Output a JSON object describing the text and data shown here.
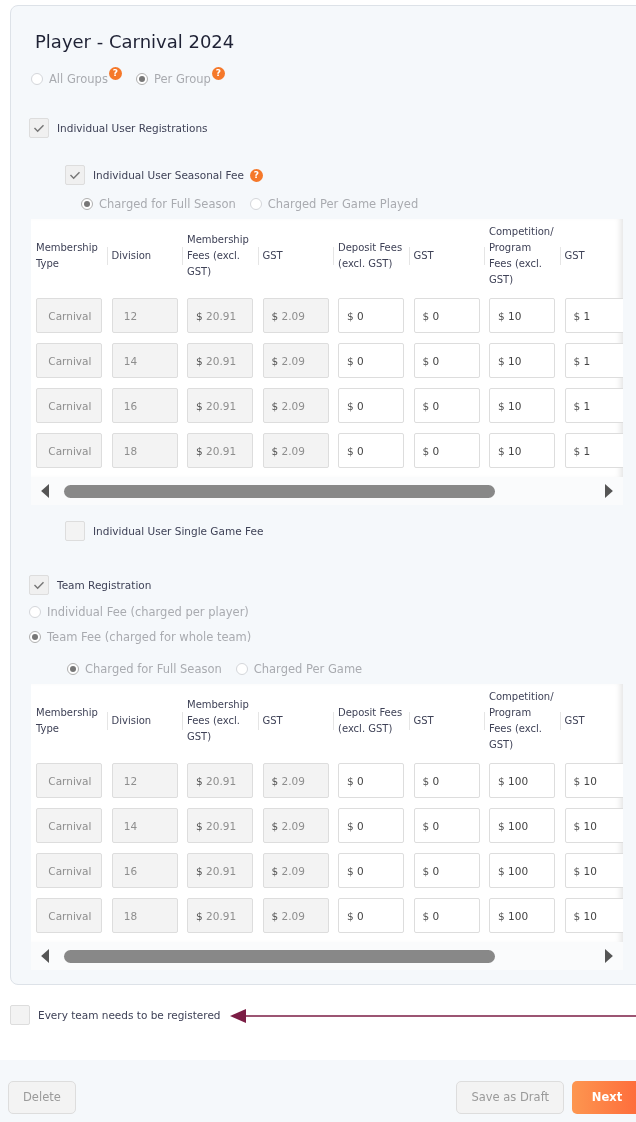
{
  "title": "Player - Carnival 2024",
  "fee_scope": {
    "disabled": true,
    "options": [
      {
        "label": "All Groups",
        "selected": false,
        "help": "?"
      },
      {
        "label": "Per Group",
        "selected": true,
        "help": "?"
      }
    ]
  },
  "individual": {
    "label": "Individual User Registrations",
    "checked": true,
    "seasonal": {
      "label": "Individual User Seasonal Fee",
      "checked": true,
      "help": "?",
      "charge": {
        "disabled": true,
        "options": [
          {
            "label": "Charged for Full Season",
            "selected": true
          },
          {
            "label": "Charged Per Game Played",
            "selected": false
          }
        ]
      },
      "table": {
        "columns": [
          "Membership Type",
          "Division",
          "Membership Fees (excl. GST)",
          "GST",
          "Deposit Fees (excl. GST)",
          "GST",
          "Competition/Program Fees (excl. GST)",
          "GST"
        ],
        "rows": [
          {
            "cells": [
              {
                "value": "Carnival",
                "disabled": true
              },
              {
                "value": "12",
                "disabled": true
              },
              {
                "prefix": "$",
                "value": "20.91",
                "disabled": true
              },
              {
                "prefix": "$",
                "value": "2.09",
                "disabled": true
              },
              {
                "prefix": "$",
                "value": "0",
                "disabled": false
              },
              {
                "prefix": "$",
                "value": "0",
                "disabled": false
              },
              {
                "prefix": "$",
                "value": "10",
                "disabled": false
              },
              {
                "prefix": "$",
                "value": "1",
                "disabled": false
              }
            ]
          },
          {
            "cells": [
              {
                "value": "Carnival",
                "disabled": true
              },
              {
                "value": "14",
                "disabled": true
              },
              {
                "prefix": "$",
                "value": "20.91",
                "disabled": true
              },
              {
                "prefix": "$",
                "value": "2.09",
                "disabled": true
              },
              {
                "prefix": "$",
                "value": "0",
                "disabled": false
              },
              {
                "prefix": "$",
                "value": "0",
                "disabled": false
              },
              {
                "prefix": "$",
                "value": "10",
                "disabled": false
              },
              {
                "prefix": "$",
                "value": "1",
                "disabled": false
              }
            ]
          },
          {
            "cells": [
              {
                "value": "Carnival",
                "disabled": true
              },
              {
                "value": "16",
                "disabled": true
              },
              {
                "prefix": "$",
                "value": "20.91",
                "disabled": true
              },
              {
                "prefix": "$",
                "value": "2.09",
                "disabled": true
              },
              {
                "prefix": "$",
                "value": "0",
                "disabled": false
              },
              {
                "prefix": "$",
                "value": "0",
                "disabled": false
              },
              {
                "prefix": "$",
                "value": "10",
                "disabled": false
              },
              {
                "prefix": "$",
                "value": "1",
                "disabled": false
              }
            ]
          },
          {
            "cells": [
              {
                "value": "Carnival",
                "disabled": true
              },
              {
                "value": "18",
                "disabled": true
              },
              {
                "prefix": "$",
                "value": "20.91",
                "disabled": true
              },
              {
                "prefix": "$",
                "value": "2.09",
                "disabled": true
              },
              {
                "prefix": "$",
                "value": "0",
                "disabled": false
              },
              {
                "prefix": "$",
                "value": "0",
                "disabled": false
              },
              {
                "prefix": "$",
                "value": "10",
                "disabled": false
              },
              {
                "prefix": "$",
                "value": "1",
                "disabled": false
              }
            ]
          }
        ]
      }
    },
    "single": {
      "label": "Individual User Single Game Fee",
      "checked": false
    }
  },
  "team": {
    "label": "Team Registration",
    "checked": true,
    "fee_type": {
      "disabled": true,
      "options": [
        {
          "label": "Individual Fee (charged per player)",
          "selected": false
        },
        {
          "label": "Team Fee (charged for whole team)",
          "selected": true
        }
      ]
    },
    "charge": {
      "disabled": true,
      "options": [
        {
          "label": "Charged for Full Season",
          "selected": true
        },
        {
          "label": "Charged Per Game",
          "selected": false
        }
      ]
    },
    "table": {
      "columns": [
        "Membership Type",
        "Division",
        "Membership Fees (excl. GST)",
        "GST",
        "Deposit Fees (excl. GST)",
        "GST",
        "Competition/Program Fees (excl. GST)",
        "GST"
      ],
      "rows": [
        {
          "cells": [
            {
              "value": "Carnival",
              "disabled": true
            },
            {
              "value": "12",
              "disabled": true
            },
            {
              "prefix": "$",
              "value": "20.91",
              "disabled": true
            },
            {
              "prefix": "$",
              "value": "2.09",
              "disabled": true
            },
            {
              "prefix": "$",
              "value": "0",
              "disabled": false
            },
            {
              "prefix": "$",
              "value": "0",
              "disabled": false
            },
            {
              "prefix": "$",
              "value": "100",
              "disabled": false
            },
            {
              "prefix": "$",
              "value": "10",
              "disabled": false
            }
          ]
        },
        {
          "cells": [
            {
              "value": "Carnival",
              "disabled": true
            },
            {
              "value": "14",
              "disabled": true
            },
            {
              "prefix": "$",
              "value": "20.91",
              "disabled": true
            },
            {
              "prefix": "$",
              "value": "2.09",
              "disabled": true
            },
            {
              "prefix": "$",
              "value": "0",
              "disabled": false
            },
            {
              "prefix": "$",
              "value": "0",
              "disabled": false
            },
            {
              "prefix": "$",
              "value": "100",
              "disabled": false
            },
            {
              "prefix": "$",
              "value": "10",
              "disabled": false
            }
          ]
        },
        {
          "cells": [
            {
              "value": "Carnival",
              "disabled": true
            },
            {
              "value": "16",
              "disabled": true
            },
            {
              "prefix": "$",
              "value": "20.91",
              "disabled": true
            },
            {
              "prefix": "$",
              "value": "2.09",
              "disabled": true
            },
            {
              "prefix": "$",
              "value": "0",
              "disabled": false
            },
            {
              "prefix": "$",
              "value": "0",
              "disabled": false
            },
            {
              "prefix": "$",
              "value": "100",
              "disabled": false
            },
            {
              "prefix": "$",
              "value": "10",
              "disabled": false
            }
          ]
        },
        {
          "cells": [
            {
              "value": "Carnival",
              "disabled": true
            },
            {
              "value": "18",
              "disabled": true
            },
            {
              "prefix": "$",
              "value": "20.91",
              "disabled": true
            },
            {
              "prefix": "$",
              "value": "2.09",
              "disabled": true
            },
            {
              "prefix": "$",
              "value": "0",
              "disabled": false
            },
            {
              "prefix": "$",
              "value": "0",
              "disabled": false
            },
            {
              "prefix": "$",
              "value": "100",
              "disabled": false
            },
            {
              "prefix": "$",
              "value": "10",
              "disabled": false
            }
          ]
        }
      ]
    }
  },
  "every_team": {
    "label": "Every team needs to be registered",
    "checked": false
  },
  "buttons": [
    {
      "label": "Delete",
      "kind": "secondary",
      "disabled": true
    },
    {
      "label": "Save as Draft",
      "kind": "secondary",
      "disabled": true
    },
    {
      "label": "Next",
      "kind": "primary",
      "disabled": false
    }
  ]
}
